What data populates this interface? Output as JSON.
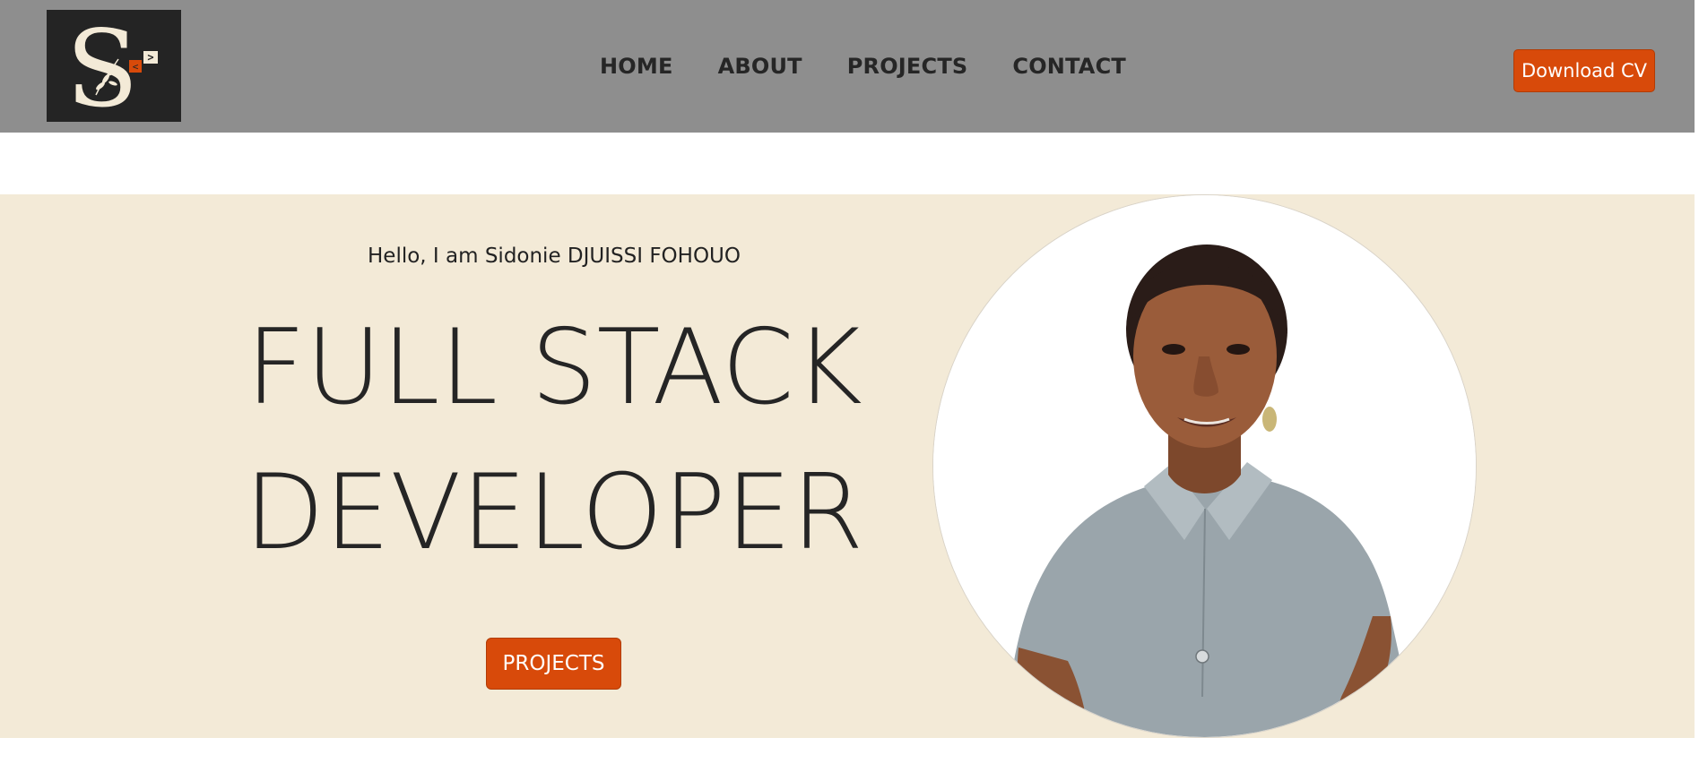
{
  "header": {
    "logo": {
      "icon": "logo-s-code-icon",
      "letter": "S",
      "code_glyph": ">",
      "brand_accent": "#d84a0a",
      "background": "#242424"
    },
    "nav": [
      {
        "label": "HOME"
      },
      {
        "label": "ABOUT"
      },
      {
        "label": "PROJECTS"
      },
      {
        "label": "CONTACT"
      }
    ],
    "download_cv_label": "Download CV"
  },
  "hero": {
    "greeting": "Hello, I am Sidonie DJUISSI FOHOUO",
    "headline_line1": "FULL STACK",
    "headline_line2": "DEVELOPER",
    "projects_button_label": "PROJECTS",
    "portrait_icon": "profile-photo"
  },
  "colors": {
    "navbar": "#8e8e8e",
    "hero_background": "#f3ead7",
    "accent": "#d84a0a",
    "text_dark": "#252525"
  }
}
